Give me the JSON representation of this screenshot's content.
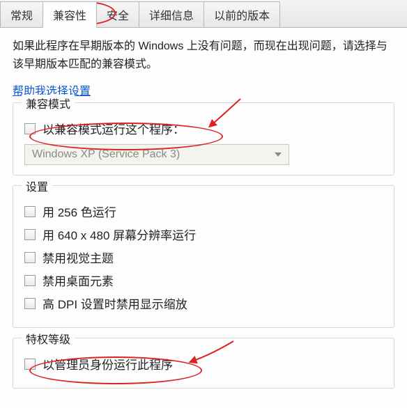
{
  "tabs": {
    "general": "常规",
    "compat": "兼容性",
    "security": "安全",
    "details": "详细信息",
    "previous": "以前的版本"
  },
  "description": "如果此程序在早期版本的 Windows 上没有问题，而现在出现问题，请选择与该早期版本匹配的兼容模式。",
  "help_link": "帮助我选择设置",
  "compat_mode": {
    "title": "兼容模式",
    "run_compat": "以兼容模式运行这个程序：",
    "os_select": "Windows XP (Service Pack 3)"
  },
  "settings": {
    "title": "设置",
    "run_256": "用 256 色运行",
    "run_640": "用 640 x 480 屏幕分辨率运行",
    "disable_themes": "禁用视觉主题",
    "disable_desktop": "禁用桌面元素",
    "disable_dpi": "高 DPI 设置时禁用显示缩放"
  },
  "privilege": {
    "title": "特权等级",
    "run_admin": "以管理员身份运行此程序"
  }
}
